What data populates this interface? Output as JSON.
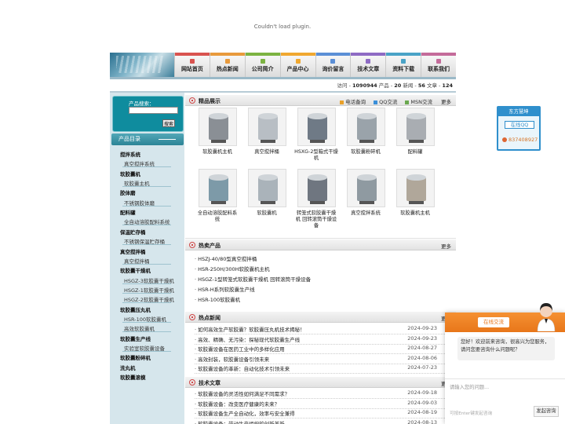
{
  "plugin_message": "Couldn't load plugin.",
  "nav": [
    {
      "label": "网站首页",
      "color": "#d9534f"
    },
    {
      "label": "热点新闻",
      "color": "#e89a3c"
    },
    {
      "label": "公司简介",
      "color": "#7cb342"
    },
    {
      "label": "产品中心",
      "color": "#f0a830"
    },
    {
      "label": "询价留言",
      "color": "#5b8fd6"
    },
    {
      "label": "技术文章",
      "color": "#8e6bc4"
    },
    {
      "label": "资料下载",
      "color": "#4aa3c7"
    },
    {
      "label": "联系我们",
      "color": "#c46b9a"
    }
  ],
  "stats": {
    "visits_label": "访问 - ",
    "visits": "1090944",
    "products_label": " 产品 - ",
    "products": "20",
    "news_label": " 新闻 - ",
    "news": "56",
    "articles_label": " 文章 - ",
    "articles": "124"
  },
  "search": {
    "label": "产品搜索：",
    "button": "搜索"
  },
  "category_title": "产品目录",
  "categories": [
    {
      "label": "搅拌系统",
      "level": "top"
    },
    {
      "label": "真空搅拌系统",
      "level": "sub"
    },
    {
      "label": "软胶囊机",
      "level": "top"
    },
    {
      "label": "软胶囊主机",
      "level": "sub"
    },
    {
      "label": "胶体磨",
      "level": "top"
    },
    {
      "label": "不锈钢胶体磨",
      "level": "sub"
    },
    {
      "label": "配料罐",
      "level": "top"
    },
    {
      "label": "全自动溶胶配料系统",
      "level": "sub"
    },
    {
      "label": "保温贮存桶",
      "level": "top"
    },
    {
      "label": "不锈钢保温贮存桶",
      "level": "sub"
    },
    {
      "label": "真空搅拌桶",
      "level": "top"
    },
    {
      "label": "真空搅拌桶",
      "level": "sub"
    },
    {
      "label": "软胶囊干燥机",
      "level": "top"
    },
    {
      "label": "HSGZ-3软胶囊干燥机",
      "level": "sub"
    },
    {
      "label": "HSGZ-1软胶囊干燥机",
      "level": "sub"
    },
    {
      "label": "HSGZ-2软胶囊干燥机",
      "level": "sub"
    },
    {
      "label": "软胶囊压丸机",
      "level": "top"
    },
    {
      "label": "HSR-100软胶囊机",
      "level": "sub"
    },
    {
      "label": "高效软胶囊机",
      "level": "sub"
    },
    {
      "label": "软胶囊生产线",
      "level": "top"
    },
    {
      "label": "实验室软胶囊设备",
      "level": "sub"
    },
    {
      "label": "软胶囊粉碎机",
      "level": "top"
    },
    {
      "label": "洗丸机",
      "level": "top"
    },
    {
      "label": "软胶囊滚模",
      "level": "top"
    }
  ],
  "featured": {
    "title": "精品展示",
    "links": [
      "电话备询",
      "QQ交流",
      "MSN交流"
    ],
    "more": "更多",
    "items": [
      {
        "name": "软胶囊机主机"
      },
      {
        "name": "真空搅拌桶"
      },
      {
        "name": "HSXG-2型箱式干燥机"
      },
      {
        "name": "软胶囊粉碎机"
      },
      {
        "name": "配料罐"
      },
      {
        "name": "全自动溶胶配料系统"
      },
      {
        "name": "软胶囊机"
      },
      {
        "name": "转笼式软胶囊干燥机 回转滚筒干燥设备"
      },
      {
        "name": "真空搅拌系统"
      },
      {
        "name": "软胶囊机主机"
      }
    ]
  },
  "hot_products": {
    "title": "热卖产品",
    "more": "更多",
    "items": [
      "· HSZJ-40/80型真空搅拌桶",
      "· HSR-250H/300H软胶囊机主机",
      "· HSGZ-1型转笼式软胶囊干燥机 回转滚筒干燥设备",
      "· HSR-H系列软胶囊生产线",
      "· HSR-100软胶囊机"
    ]
  },
  "news": {
    "title": "热点新闻",
    "more": "更多",
    "items": [
      {
        "title": "· 如何高效生产软胶囊？软胶囊压丸机技术揭秘！",
        "date": "2024-09-23"
      },
      {
        "title": "· 高效、精确、无污染：探秘现代软胶囊生产线",
        "date": "2024-09-23"
      },
      {
        "title": "· 软胶囊设备在医药工业中的多样化应用",
        "date": "2024-08-27"
      },
      {
        "title": "· 高效封装，软胶囊设备引领未来",
        "date": "2024-08-06"
      },
      {
        "title": "· 软胶囊设备的革新：自动化技术引领未来",
        "date": "2024-07-23"
      }
    ]
  },
  "articles": {
    "title": "技术文章",
    "more": "更多",
    "items": [
      {
        "title": "· 软胶囊设备的灵活性如何满足不同需求？",
        "date": "2024-09-18"
      },
      {
        "title": "· 软胶囊设备：改变医疗健康的未来？",
        "date": "2024-09-03"
      },
      {
        "title": "· 软胶囊设备生产全自动化，效率与安全兼得",
        "date": "2024-08-19"
      },
      {
        "title": "· 软胶囊设备：带动生产组织的创新革新",
        "date": "2024-08-13"
      }
    ]
  },
  "qq_float": {
    "title": "东方慧坤",
    "button": "在线QQ",
    "phone": "837408927"
  },
  "chat": {
    "tab": "在线交流",
    "greeting": "您好！欢迎前来咨询，很高兴为您服务，请问您要咨询什么问题呢？",
    "placeholder": "请输入您的问题...",
    "hint": "可按Enter键发起咨询",
    "send": "发起咨询"
  }
}
